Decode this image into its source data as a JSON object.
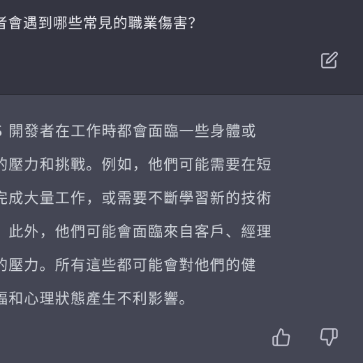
{
  "user_message": {
    "text": "者會遇到哪些常見的職業傷害？",
    "edit_icon": "edit-icon"
  },
  "assistant_message": {
    "lines": [
      "S 開發者在工作時都會面臨一些身體或",
      "的壓力和挑戰。例如，他們可能需要在短",
      "完成大量工作，或需要不斷學習新的技術",
      "。此外，他們可能會面臨來自客戶、經理",
      "的壓力。所有這些都可能會對他們的健",
      "福和心理狀態產生不利影響。"
    ],
    "feedback_icons": [
      "thumbs-up-icon",
      "thumbs-down-icon"
    ]
  },
  "colors": {
    "user_bg": "#343541",
    "assistant_bg": "#444654",
    "text": "#d1d5db",
    "icon": "#c5c5d2"
  }
}
